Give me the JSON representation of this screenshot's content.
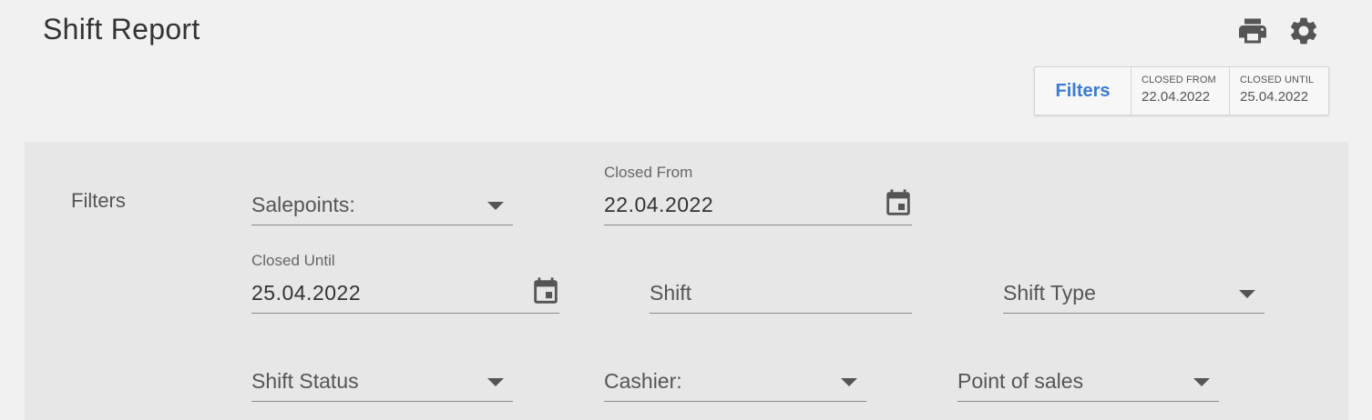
{
  "header": {
    "title": "Shift Report",
    "icons": {
      "print": "print-icon",
      "settings": "gear-icon"
    }
  },
  "filter_summary": {
    "button_label": "Filters",
    "chips": [
      {
        "label": "CLOSED FROM",
        "value": "22.04.2022"
      },
      {
        "label": "CLOSED UNTIL",
        "value": "25.04.2022"
      }
    ]
  },
  "filters_panel": {
    "title": "Filters",
    "salepoints": {
      "label": "Salepoints:",
      "value": ""
    },
    "closed_from": {
      "caption": "Closed From",
      "value": "22.04.2022"
    },
    "closed_until": {
      "caption": "Closed Until",
      "value": "25.04.2022"
    },
    "shift": {
      "label": "Shift",
      "value": ""
    },
    "shift_type": {
      "label": "Shift Type",
      "value": ""
    },
    "shift_status": {
      "label": "Shift Status",
      "value": ""
    },
    "cashier": {
      "label": "Cashier:",
      "value": ""
    },
    "point_of_sales": {
      "label": "Point of sales",
      "value": ""
    }
  },
  "colors": {
    "background": "#f1f1f1",
    "panel": "#e7e7e7",
    "accent": "#3a7bd5",
    "text": "#424242"
  }
}
